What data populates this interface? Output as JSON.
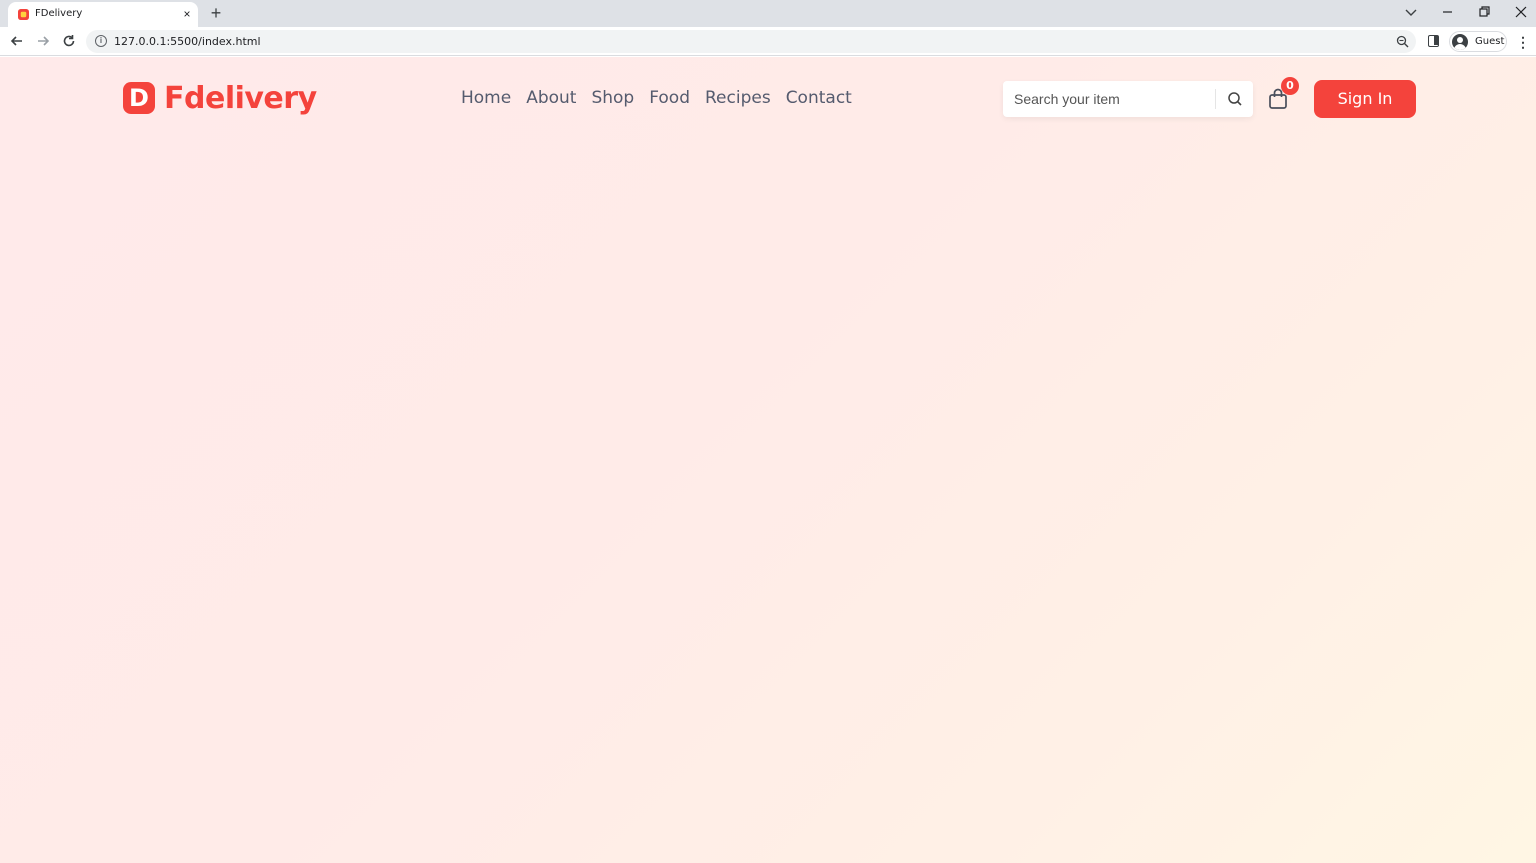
{
  "browser": {
    "tab_title": "FDelivery",
    "tab_close_glyph": "×",
    "new_tab_glyph": "+",
    "url": "127.0.0.1:5500/index.html",
    "profile_name": "Guest",
    "icons": [
      "favicon",
      "close-icon",
      "plus-icon",
      "chevron-down-icon",
      "minimize-icon",
      "restore-icon",
      "close-window-icon",
      "back-arrow-icon",
      "forward-arrow-icon",
      "reload-icon",
      "info-icon",
      "zoom-icon",
      "side-panel-icon",
      "avatar",
      "kebab-menu-icon"
    ]
  },
  "header": {
    "logo_mark": "D",
    "logo_text": "Fdelivery",
    "nav": [
      "Home",
      "About",
      "Shop",
      "Food",
      "Recipes",
      "Contact"
    ],
    "search_placeholder": "Search your item",
    "cart_count": "0",
    "signin_label": "Sign In"
  },
  "colors": {
    "accent": "#f4433c",
    "nav_text": "#555b6e",
    "background_start": "#ffeaea",
    "background_end": "#fff6e4"
  }
}
